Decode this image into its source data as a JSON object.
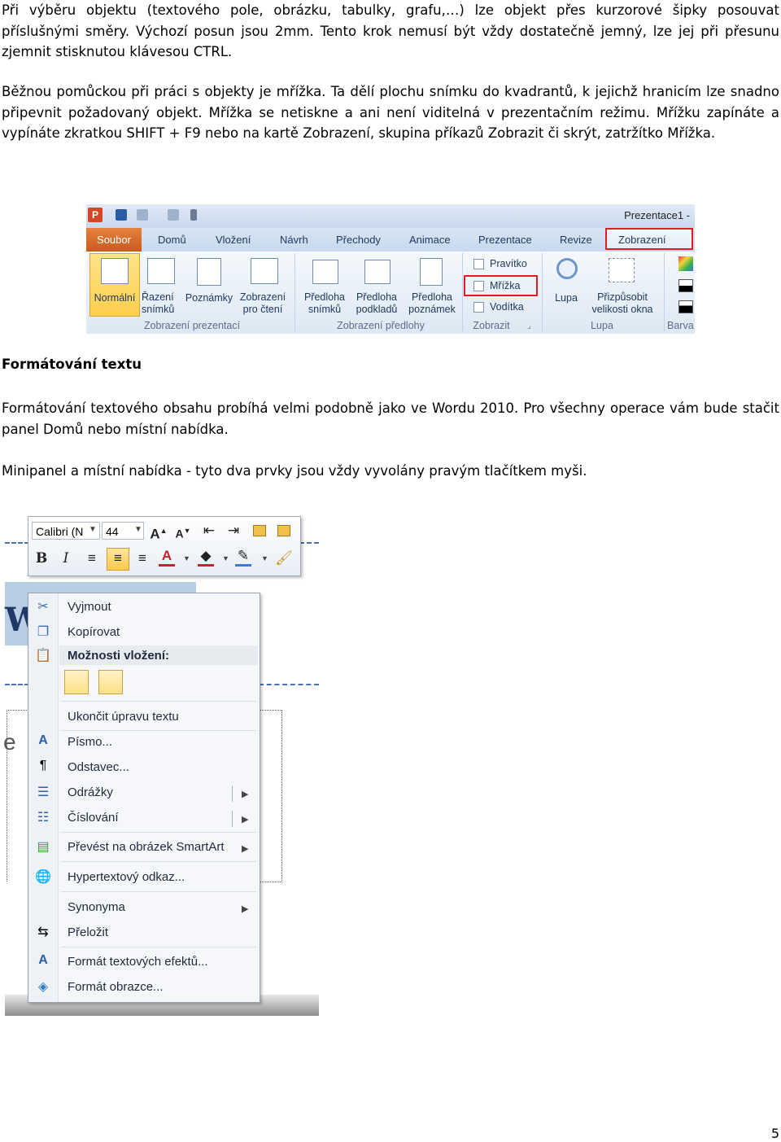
{
  "paragraphs": [
    "Při výběru objektu (textového pole, obrázku, tabulky, grafu,…) lze objekt přes kurzorové šipky posouvat příslušnými směry. Výchozí posun jsou 2mm. Tento krok nemusí být vždy dostatečně jemný, lze jej při přesunu zjemnit stisknutou klávesou CTRL.",
    "Běžnou pomůckou při práci s objekty je mřížka. Ta dělí plochu snímku do kvadrantů, k jejichž hranicím lze snadno připevnit požadovaný objekt. Mřížka se netiskne a ani není viditelná v prezentačním režimu. Mřížku zapínáte a vypínáte zkratkou SHIFT + F9 nebo na kartě Zobrazení, skupina příkazů Zobrazit či skrýt, zatržítko Mřížka."
  ],
  "ribbon": {
    "window_title": "Prezentace1 -",
    "logo": "P",
    "tabs": [
      "Soubor",
      "Domů",
      "Vložení",
      "Návrh",
      "Přechody",
      "Animace",
      "Prezentace",
      "Revize",
      "Zobrazení"
    ],
    "buttons": {
      "normal": "Normální",
      "sorter": [
        "Řazení",
        "snímků"
      ],
      "notes": "Poznámky",
      "reading": [
        "Zobrazení",
        "pro čtení"
      ],
      "slide_master": [
        "Předloha",
        "snímků"
      ],
      "handout_master": [
        "Předloha",
        "podkladů"
      ],
      "notes_master": [
        "Předloha",
        "poznámek"
      ],
      "zoom": "Lupa",
      "fit": [
        "Přizpůsobit",
        "velikosti okna"
      ]
    },
    "checkboxes": [
      "Pravítko",
      "Mřížka",
      "Vodítka"
    ],
    "groups": [
      "Zobrazení prezentací",
      "Zobrazení předlohy",
      "Zobrazit",
      "Lupa",
      "Barva"
    ]
  },
  "heading": "Formátování textu",
  "paragraphs2": [
    "Formátování textového obsahu probíhá velmi podobně jako ve Wordu 2010. Pro všechny operace vám bude stačit panel Domů nebo místní nabídka.",
    "Minipanel a místní nabídka - tyto dva prvky jsou vždy vyvolány pravým tlačítkem myši."
  ],
  "minitoolbar": {
    "font": "Calibri (N",
    "size": "44"
  },
  "menu": {
    "items": [
      "Vyjmout",
      "Kopírovat",
      "Možnosti vložení:",
      "Ukončit úpravu textu",
      "Písmo...",
      "Odstavec...",
      "Odrážky",
      "Číslování",
      "Převést na obrázek SmartArt",
      "Hypertextový odkaz...",
      "Synonyma",
      "Přeložit",
      "Formát textových efektů...",
      "Formát obrazce..."
    ]
  },
  "page_number": "5"
}
